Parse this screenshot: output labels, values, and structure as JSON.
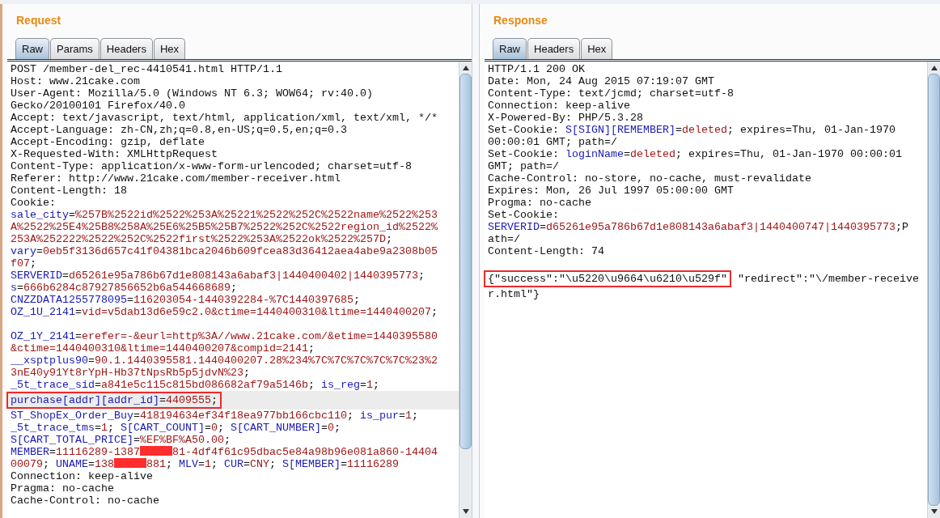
{
  "panels": [
    {
      "title": "Request",
      "tabs": [
        {
          "label": "Raw",
          "selected": true
        },
        {
          "label": "Params",
          "selected": false
        },
        {
          "label": "Headers",
          "selected": false
        },
        {
          "label": "Hex",
          "selected": false
        }
      ],
      "lines": [
        {
          "segs": [
            {
              "kind": "plain",
              "text": "POST /member-del_rec-4410541.html HTTP/1.1"
            }
          ]
        },
        {
          "segs": [
            {
              "kind": "plain",
              "text": "Host: www.21cake.com"
            }
          ]
        },
        {
          "segs": [
            {
              "kind": "plain",
              "text": "User-Agent: Mozilla/5.0 (Windows NT 6.3; WOW64; rv:40.0)"
            }
          ]
        },
        {
          "segs": [
            {
              "kind": "plain",
              "text": "Gecko/20100101 Firefox/40.0"
            }
          ]
        },
        {
          "segs": [
            {
              "kind": "plain",
              "text": "Accept: text/javascript, text/html, application/xml, text/xml, */*"
            }
          ]
        },
        {
          "segs": [
            {
              "kind": "plain",
              "text": "Accept-Language: zh-CN,zh;q=0.8,en-US;q=0.5,en;q=0.3"
            }
          ]
        },
        {
          "segs": [
            {
              "kind": "plain",
              "text": "Accept-Encoding: gzip, deflate"
            }
          ]
        },
        {
          "segs": [
            {
              "kind": "plain",
              "text": "X-Requested-With: XMLHttpRequest"
            }
          ]
        },
        {
          "segs": [
            {
              "kind": "plain",
              "text": "Content-Type: application/x-www-form-urlencoded; charset=utf-8"
            }
          ]
        },
        {
          "segs": [
            {
              "kind": "plain",
              "text": "Referer: http://www.21cake.com/member-receiver.html"
            }
          ]
        },
        {
          "segs": [
            {
              "kind": "plain",
              "text": "Content-Length: 18"
            }
          ]
        },
        {
          "segs": [
            {
              "kind": "plain",
              "text": "Cookie:"
            }
          ]
        },
        {
          "segs": [
            {
              "kind": "name",
              "text": "sale_city"
            },
            {
              "kind": "plain",
              "text": "="
            },
            {
              "kind": "value",
              "text": "%257B%2522id%2522%253A%25221%2522%252C%2522name%2522%253"
            }
          ]
        },
        {
          "segs": [
            {
              "kind": "value",
              "text": "A%2522%25E4%25B8%258A%25E6%25B5%25B7%2522%252C%2522region_id%2522%"
            }
          ]
        },
        {
          "segs": [
            {
              "kind": "value",
              "text": "253A%252222%2522%252C%2522first%2522%253A%2522ok%2522%257D"
            },
            {
              "kind": "plain",
              "text": ";"
            }
          ]
        },
        {
          "segs": [
            {
              "kind": "name",
              "text": "vary"
            },
            {
              "kind": "plain",
              "text": "="
            },
            {
              "kind": "value",
              "text": "0eb5f3136d657c41f04381bca2046b609fcea83d36412aea4abe9a2308b05"
            }
          ]
        },
        {
          "segs": [
            {
              "kind": "value",
              "text": "f07"
            },
            {
              "kind": "plain",
              "text": ";"
            }
          ]
        },
        {
          "segs": [
            {
              "kind": "name",
              "text": "SERVERID"
            },
            {
              "kind": "plain",
              "text": "="
            },
            {
              "kind": "value",
              "text": "d65261e95a786b67d1e808143a6abaf3|1440400402|1440395773"
            },
            {
              "kind": "plain",
              "text": ";"
            }
          ]
        },
        {
          "segs": [
            {
              "kind": "name",
              "text": "s"
            },
            {
              "kind": "plain",
              "text": "="
            },
            {
              "kind": "value",
              "text": "666b6284c87927856652b6a544668689"
            },
            {
              "kind": "plain",
              "text": ";"
            }
          ]
        },
        {
          "segs": [
            {
              "kind": "name",
              "text": "CNZZDATA1255778095"
            },
            {
              "kind": "plain",
              "text": "="
            },
            {
              "kind": "value",
              "text": "116203054-1440392284-%7C1440397685"
            },
            {
              "kind": "plain",
              "text": ";"
            }
          ]
        },
        {
          "segs": [
            {
              "kind": "name",
              "text": "OZ_1U_2141"
            },
            {
              "kind": "plain",
              "text": "="
            },
            {
              "kind": "value",
              "text": "vid=v5dab13d6e59c2.0&ctime=1440400310&ltime=1440400207"
            },
            {
              "kind": "plain",
              "text": ";"
            }
          ]
        },
        {
          "blank_line_before": true,
          "segs": [
            {
              "kind": "name",
              "text": "OZ_1Y_2141"
            },
            {
              "kind": "plain",
              "text": "="
            },
            {
              "kind": "value",
              "text": "erefer=-&eurl=http%3A//www.21cake.com/&etime=1440395580"
            }
          ]
        },
        {
          "segs": [
            {
              "kind": "value",
              "text": "&ctime=1440400310&ltime=1440400207&compid=2141"
            },
            {
              "kind": "plain",
              "text": ";"
            }
          ]
        },
        {
          "segs": [
            {
              "kind": "name",
              "text": "__xsptplus90"
            },
            {
              "kind": "plain",
              "text": "="
            },
            {
              "kind": "value",
              "text": "90.1.1440395581.1440400207.28%234%7C%7C%7C%7C%7C%23%2"
            }
          ]
        },
        {
          "segs": [
            {
              "kind": "value",
              "text": "3nE40y91Yt8rYpH-Hb37tNpsRb5p5jdvN%23"
            },
            {
              "kind": "plain",
              "text": ";"
            }
          ]
        },
        {
          "segs": [
            {
              "kind": "name",
              "text": "_5t_trace_sid"
            },
            {
              "kind": "plain",
              "text": "="
            },
            {
              "kind": "value",
              "text": "a841e5c115c815bd086682af79a5146b"
            },
            {
              "kind": "plain",
              "text": "; "
            },
            {
              "kind": "name",
              "text": "is_reg"
            },
            {
              "kind": "plain",
              "text": "="
            },
            {
              "kind": "value",
              "text": "1"
            },
            {
              "kind": "plain",
              "text": ";"
            }
          ]
        },
        {
          "current": true,
          "segs": [
            {
              "kind": "name",
              "text": "purchase[addr][addr_id]",
              "boxed": true
            },
            {
              "kind": "plain",
              "text": "=",
              "boxed": true
            },
            {
              "kind": "value",
              "text": "4409555",
              "boxed": true
            },
            {
              "kind": "plain",
              "text": ";",
              "boxed": true
            }
          ]
        },
        {
          "segs": [
            {
              "kind": "name",
              "text": "ST_ShopEx_Order_Buy"
            },
            {
              "kind": "plain",
              "text": "="
            },
            {
              "kind": "value",
              "text": "418194634ef34f18ea977bb166cbc110"
            },
            {
              "kind": "plain",
              "text": "; "
            },
            {
              "kind": "name",
              "text": "is_pur"
            },
            {
              "kind": "plain",
              "text": "="
            },
            {
              "kind": "value",
              "text": "1"
            },
            {
              "kind": "plain",
              "text": ";"
            }
          ]
        },
        {
          "segs": [
            {
              "kind": "name",
              "text": "_5t_trace_tms"
            },
            {
              "kind": "plain",
              "text": "="
            },
            {
              "kind": "value",
              "text": "1"
            },
            {
              "kind": "plain",
              "text": "; "
            },
            {
              "kind": "name",
              "text": "S[CART_COUNT]"
            },
            {
              "kind": "plain",
              "text": "="
            },
            {
              "kind": "value",
              "text": "0"
            },
            {
              "kind": "plain",
              "text": "; "
            },
            {
              "kind": "name",
              "text": "S[CART_NUMBER]"
            },
            {
              "kind": "plain",
              "text": "="
            },
            {
              "kind": "value",
              "text": "0"
            },
            {
              "kind": "plain",
              "text": ";"
            }
          ]
        },
        {
          "segs": [
            {
              "kind": "name",
              "text": "S[CART_TOTAL_PRICE]"
            },
            {
              "kind": "plain",
              "text": "="
            },
            {
              "kind": "value",
              "text": "%EF%BF%A50.00"
            },
            {
              "kind": "plain",
              "text": ";"
            }
          ]
        },
        {
          "segs": [
            {
              "kind": "name",
              "text": "MEMBER"
            },
            {
              "kind": "plain",
              "text": "="
            },
            {
              "kind": "value",
              "text": "11116289-1387"
            },
            {
              "kind": "redacted"
            },
            {
              "kind": "value",
              "text": "81-4df4f61c95dbac5e84a98b96e081a860-14404"
            }
          ]
        },
        {
          "segs": [
            {
              "kind": "value",
              "text": "00079"
            },
            {
              "kind": "plain",
              "text": "; "
            },
            {
              "kind": "name",
              "text": "UNAME"
            },
            {
              "kind": "plain",
              "text": "="
            },
            {
              "kind": "value",
              "text": "138"
            },
            {
              "kind": "redacted"
            },
            {
              "kind": "value",
              "text": "881"
            },
            {
              "kind": "plain",
              "text": "; "
            },
            {
              "kind": "name",
              "text": "MLV"
            },
            {
              "kind": "plain",
              "text": "="
            },
            {
              "kind": "value",
              "text": "1"
            },
            {
              "kind": "plain",
              "text": "; "
            },
            {
              "kind": "name",
              "text": "CUR"
            },
            {
              "kind": "plain",
              "text": "="
            },
            {
              "kind": "value",
              "text": "CNY"
            },
            {
              "kind": "plain",
              "text": "; "
            },
            {
              "kind": "name",
              "text": "S[MEMBER]"
            },
            {
              "kind": "plain",
              "text": "="
            },
            {
              "kind": "value",
              "text": "11116289"
            }
          ]
        },
        {
          "segs": [
            {
              "kind": "plain",
              "text": "Connection: keep-alive"
            }
          ]
        },
        {
          "segs": [
            {
              "kind": "plain",
              "text": "Pragma: no-cache"
            }
          ]
        },
        {
          "segs": [
            {
              "kind": "plain",
              "text": "Cache-Control: no-cache"
            }
          ]
        }
      ]
    },
    {
      "title": "Response",
      "tabs": [
        {
          "label": "Raw",
          "selected": true
        },
        {
          "label": "Headers",
          "selected": false
        },
        {
          "label": "Hex",
          "selected": false
        }
      ],
      "lines": [
        {
          "segs": [
            {
              "kind": "plain",
              "text": "HTTP/1.1 200 OK"
            }
          ]
        },
        {
          "segs": [
            {
              "kind": "plain",
              "text": "Date: Mon, 24 Aug 2015 07:19:07 GMT"
            }
          ]
        },
        {
          "segs": [
            {
              "kind": "plain",
              "text": "Content-Type: text/jcmd; charset=utf-8"
            }
          ]
        },
        {
          "segs": [
            {
              "kind": "plain",
              "text": "Connection: keep-alive"
            }
          ]
        },
        {
          "segs": [
            {
              "kind": "plain",
              "text": "X-Powered-By: PHP/5.3.28"
            }
          ]
        },
        {
          "segs": [
            {
              "kind": "plain",
              "text": "Set-Cookie: "
            },
            {
              "kind": "name",
              "text": "S[SIGN][REMEMBER]"
            },
            {
              "kind": "plain",
              "text": "="
            },
            {
              "kind": "value",
              "text": "deleted"
            },
            {
              "kind": "plain",
              "text": "; expires=Thu, 01-Jan-1970"
            }
          ]
        },
        {
          "segs": [
            {
              "kind": "plain",
              "text": "00:00:01 GMT; path=/"
            }
          ]
        },
        {
          "segs": [
            {
              "kind": "plain",
              "text": "Set-Cookie: "
            },
            {
              "kind": "name",
              "text": "loginName"
            },
            {
              "kind": "plain",
              "text": "="
            },
            {
              "kind": "value",
              "text": "deleted"
            },
            {
              "kind": "plain",
              "text": "; expires=Thu, 01-Jan-1970 00:00:01"
            }
          ]
        },
        {
          "segs": [
            {
              "kind": "plain",
              "text": "GMT; path=/"
            }
          ]
        },
        {
          "segs": [
            {
              "kind": "plain",
              "text": "Cache-Control: no-store, no-cache, must-revalidate"
            }
          ]
        },
        {
          "segs": [
            {
              "kind": "plain",
              "text": "Expires: Mon, 26 Jul 1997 05:00:00 GMT"
            }
          ]
        },
        {
          "segs": [
            {
              "kind": "plain",
              "text": "Progma: no-cache"
            }
          ]
        },
        {
          "segs": [
            {
              "kind": "plain",
              "text": "Set-Cookie:"
            }
          ]
        },
        {
          "segs": [
            {
              "kind": "name",
              "text": "SERVERID"
            },
            {
              "kind": "plain",
              "text": "="
            },
            {
              "kind": "value",
              "text": "d65261e95a786b67d1e808143a6abaf3|1440400747|1440395773"
            },
            {
              "kind": "plain",
              "text": ";P"
            }
          ]
        },
        {
          "segs": [
            {
              "kind": "plain",
              "text": "ath=/"
            }
          ]
        },
        {
          "segs": [
            {
              "kind": "plain",
              "text": "Content-Length: 74"
            }
          ]
        },
        {
          "blank_line_before": true,
          "segs": [
            {
              "kind": "plain",
              "text": "{\"success\":\"\\u5220\\u9664\\u6210\\u529f\"",
              "boxed": true
            },
            {
              "kind": "plain",
              "text": " \"redirect\":\"\\/member-receive"
            }
          ]
        },
        {
          "segs": [
            {
              "kind": "plain",
              "text": "r.html\"}"
            }
          ]
        }
      ]
    }
  ]
}
